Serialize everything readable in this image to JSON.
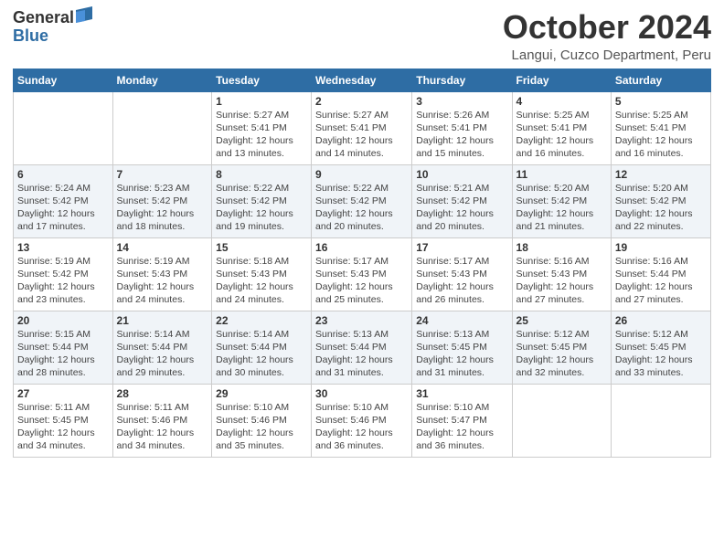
{
  "logo": {
    "general": "General",
    "blue": "Blue"
  },
  "header": {
    "month": "October 2024",
    "location": "Langui, Cuzco Department, Peru"
  },
  "weekdays": [
    "Sunday",
    "Monday",
    "Tuesday",
    "Wednesday",
    "Thursday",
    "Friday",
    "Saturday"
  ],
  "weeks": [
    [
      {
        "day": null,
        "info": null
      },
      {
        "day": null,
        "info": null
      },
      {
        "day": "1",
        "info": "Sunrise: 5:27 AM\nSunset: 5:41 PM\nDaylight: 12 hours and 13 minutes."
      },
      {
        "day": "2",
        "info": "Sunrise: 5:27 AM\nSunset: 5:41 PM\nDaylight: 12 hours and 14 minutes."
      },
      {
        "day": "3",
        "info": "Sunrise: 5:26 AM\nSunset: 5:41 PM\nDaylight: 12 hours and 15 minutes."
      },
      {
        "day": "4",
        "info": "Sunrise: 5:25 AM\nSunset: 5:41 PM\nDaylight: 12 hours and 16 minutes."
      },
      {
        "day": "5",
        "info": "Sunrise: 5:25 AM\nSunset: 5:41 PM\nDaylight: 12 hours and 16 minutes."
      }
    ],
    [
      {
        "day": "6",
        "info": "Sunrise: 5:24 AM\nSunset: 5:42 PM\nDaylight: 12 hours and 17 minutes."
      },
      {
        "day": "7",
        "info": "Sunrise: 5:23 AM\nSunset: 5:42 PM\nDaylight: 12 hours and 18 minutes."
      },
      {
        "day": "8",
        "info": "Sunrise: 5:22 AM\nSunset: 5:42 PM\nDaylight: 12 hours and 19 minutes."
      },
      {
        "day": "9",
        "info": "Sunrise: 5:22 AM\nSunset: 5:42 PM\nDaylight: 12 hours and 20 minutes."
      },
      {
        "day": "10",
        "info": "Sunrise: 5:21 AM\nSunset: 5:42 PM\nDaylight: 12 hours and 20 minutes."
      },
      {
        "day": "11",
        "info": "Sunrise: 5:20 AM\nSunset: 5:42 PM\nDaylight: 12 hours and 21 minutes."
      },
      {
        "day": "12",
        "info": "Sunrise: 5:20 AM\nSunset: 5:42 PM\nDaylight: 12 hours and 22 minutes."
      }
    ],
    [
      {
        "day": "13",
        "info": "Sunrise: 5:19 AM\nSunset: 5:42 PM\nDaylight: 12 hours and 23 minutes."
      },
      {
        "day": "14",
        "info": "Sunrise: 5:19 AM\nSunset: 5:43 PM\nDaylight: 12 hours and 24 minutes."
      },
      {
        "day": "15",
        "info": "Sunrise: 5:18 AM\nSunset: 5:43 PM\nDaylight: 12 hours and 24 minutes."
      },
      {
        "day": "16",
        "info": "Sunrise: 5:17 AM\nSunset: 5:43 PM\nDaylight: 12 hours and 25 minutes."
      },
      {
        "day": "17",
        "info": "Sunrise: 5:17 AM\nSunset: 5:43 PM\nDaylight: 12 hours and 26 minutes."
      },
      {
        "day": "18",
        "info": "Sunrise: 5:16 AM\nSunset: 5:43 PM\nDaylight: 12 hours and 27 minutes."
      },
      {
        "day": "19",
        "info": "Sunrise: 5:16 AM\nSunset: 5:44 PM\nDaylight: 12 hours and 27 minutes."
      }
    ],
    [
      {
        "day": "20",
        "info": "Sunrise: 5:15 AM\nSunset: 5:44 PM\nDaylight: 12 hours and 28 minutes."
      },
      {
        "day": "21",
        "info": "Sunrise: 5:14 AM\nSunset: 5:44 PM\nDaylight: 12 hours and 29 minutes."
      },
      {
        "day": "22",
        "info": "Sunrise: 5:14 AM\nSunset: 5:44 PM\nDaylight: 12 hours and 30 minutes."
      },
      {
        "day": "23",
        "info": "Sunrise: 5:13 AM\nSunset: 5:44 PM\nDaylight: 12 hours and 31 minutes."
      },
      {
        "day": "24",
        "info": "Sunrise: 5:13 AM\nSunset: 5:45 PM\nDaylight: 12 hours and 31 minutes."
      },
      {
        "day": "25",
        "info": "Sunrise: 5:12 AM\nSunset: 5:45 PM\nDaylight: 12 hours and 32 minutes."
      },
      {
        "day": "26",
        "info": "Sunrise: 5:12 AM\nSunset: 5:45 PM\nDaylight: 12 hours and 33 minutes."
      }
    ],
    [
      {
        "day": "27",
        "info": "Sunrise: 5:11 AM\nSunset: 5:45 PM\nDaylight: 12 hours and 34 minutes."
      },
      {
        "day": "28",
        "info": "Sunrise: 5:11 AM\nSunset: 5:46 PM\nDaylight: 12 hours and 34 minutes."
      },
      {
        "day": "29",
        "info": "Sunrise: 5:10 AM\nSunset: 5:46 PM\nDaylight: 12 hours and 35 minutes."
      },
      {
        "day": "30",
        "info": "Sunrise: 5:10 AM\nSunset: 5:46 PM\nDaylight: 12 hours and 36 minutes."
      },
      {
        "day": "31",
        "info": "Sunrise: 5:10 AM\nSunset: 5:47 PM\nDaylight: 12 hours and 36 minutes."
      },
      {
        "day": null,
        "info": null
      },
      {
        "day": null,
        "info": null
      }
    ]
  ]
}
